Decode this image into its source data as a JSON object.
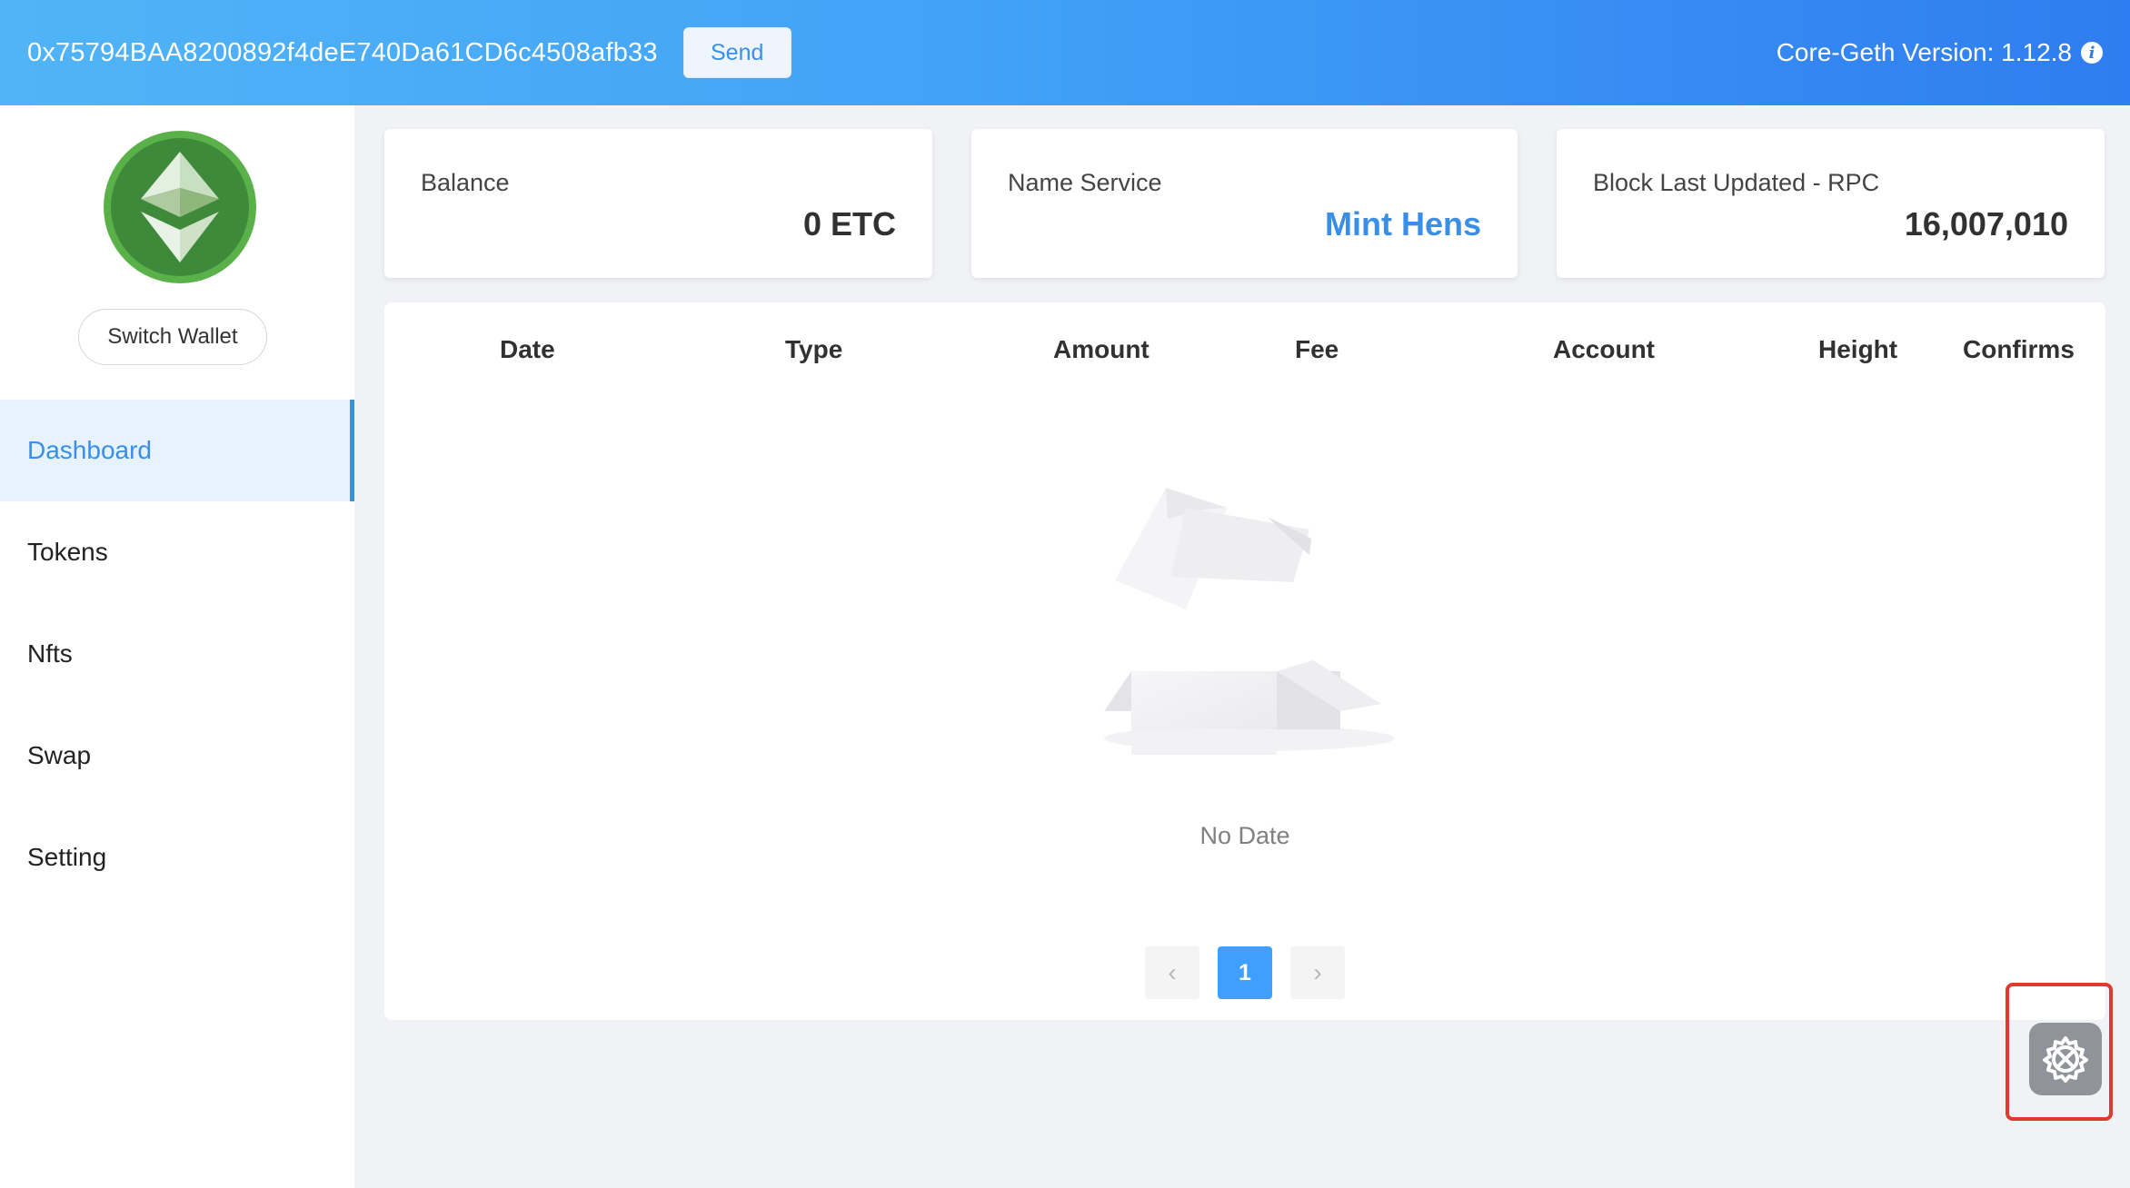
{
  "header": {
    "address": "0x75794BAA8200892f4deE740Da61CD6c4508afb33",
    "send_label": "Send",
    "version_text": "Core-Geth Version: 1.12.8",
    "info_glyph": "i"
  },
  "sidebar": {
    "switch_wallet_label": "Switch Wallet",
    "items": [
      {
        "label": "Dashboard"
      },
      {
        "label": "Tokens"
      },
      {
        "label": "Nfts"
      },
      {
        "label": "Swap"
      },
      {
        "label": "Setting"
      }
    ],
    "active_index": 0
  },
  "cards": {
    "balance": {
      "label": "Balance",
      "value": "0 ETC"
    },
    "name_service": {
      "label": "Name Service",
      "value": "Mint Hens"
    },
    "block": {
      "label": "Block Last Updated - RPC",
      "value": "16,007,010"
    }
  },
  "table": {
    "columns": [
      "Date",
      "Type",
      "Amount",
      "Fee",
      "Account",
      "Height",
      "Confirms"
    ],
    "empty_text": "No Date"
  },
  "pagination": {
    "prev_glyph": "‹",
    "current_page": "1",
    "next_glyph": "›"
  },
  "icons": {
    "logo": "ethereum-classic-logo-icon",
    "info": "info-icon",
    "empty": "empty-box-icon",
    "settings": "settings-tools-icon"
  },
  "colors": {
    "accent": "#3a8ee6",
    "header_start": "#51b4f7",
    "header_end": "#2f7df0",
    "highlight": "#e03a2e"
  }
}
